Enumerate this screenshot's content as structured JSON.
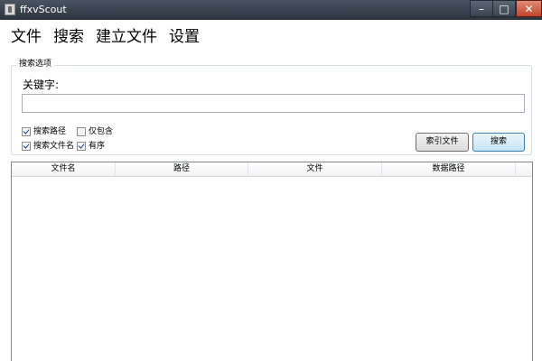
{
  "window": {
    "title": "ffxvScout",
    "controls": {
      "minimize": "–",
      "maximize": "□",
      "close": "✕"
    }
  },
  "menu": [
    "文件",
    "搜索",
    "建立文件",
    "设置"
  ],
  "search_options": {
    "group_title": "搜索选项",
    "keyword_label": "关键字:",
    "keyword_value": "",
    "checkboxes": [
      {
        "label": "搜索路径",
        "checked": true
      },
      {
        "label": "仅包含",
        "checked": false
      },
      {
        "label": "搜索文件名",
        "checked": true
      },
      {
        "label": "有序",
        "checked": true
      }
    ],
    "buttons": {
      "index_files": "索引文件",
      "search": "搜索"
    }
  },
  "results": {
    "columns": [
      "文件名",
      "路径",
      "文件",
      "数据路径"
    ],
    "rows": []
  },
  "colors": {
    "titlebar": "#2b333d",
    "close_button": "#c0452a",
    "primary_button_border": "#3c7fb1",
    "group_border": "#d5dfe5"
  }
}
